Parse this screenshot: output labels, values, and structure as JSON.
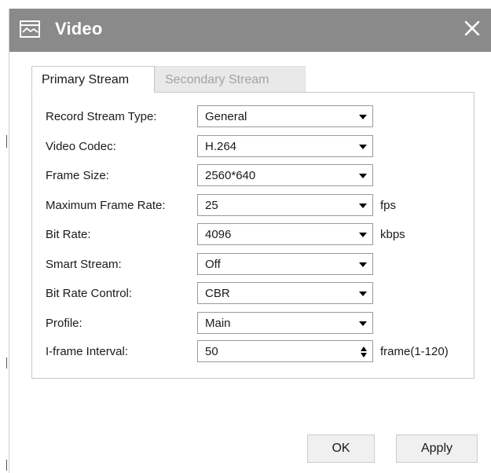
{
  "dialog": {
    "title": "Video",
    "close_icon": "close-icon",
    "title_icon": "video-window-icon",
    "titlebar_color": "#8a8a8a"
  },
  "tabs": [
    {
      "label": "Primary Stream",
      "active": true
    },
    {
      "label": "Secondary Stream",
      "active": false
    }
  ],
  "fields": [
    {
      "label": "Record Stream Type:",
      "value": "General",
      "control": "select",
      "unit": ""
    },
    {
      "label": "Video Codec:",
      "value": "H.264",
      "control": "select",
      "unit": ""
    },
    {
      "label": "Frame Size:",
      "value": "2560*640",
      "control": "select",
      "unit": ""
    },
    {
      "label": "Maximum Frame Rate:",
      "value": "25",
      "control": "select",
      "unit": "fps"
    },
    {
      "label": "Bit Rate:",
      "value": "4096",
      "control": "select",
      "unit": "kbps"
    },
    {
      "label": "Smart Stream:",
      "value": "Off",
      "control": "select",
      "unit": ""
    },
    {
      "label": "Bit Rate Control:",
      "value": "CBR",
      "control": "select",
      "unit": ""
    },
    {
      "label": "Profile:",
      "value": "Main",
      "control": "select",
      "unit": ""
    },
    {
      "label": "I-frame Interval:",
      "value": "50",
      "control": "spinner",
      "unit": "frame(1-120)"
    }
  ],
  "buttons": {
    "ok_label": "OK",
    "apply_label": "Apply"
  }
}
